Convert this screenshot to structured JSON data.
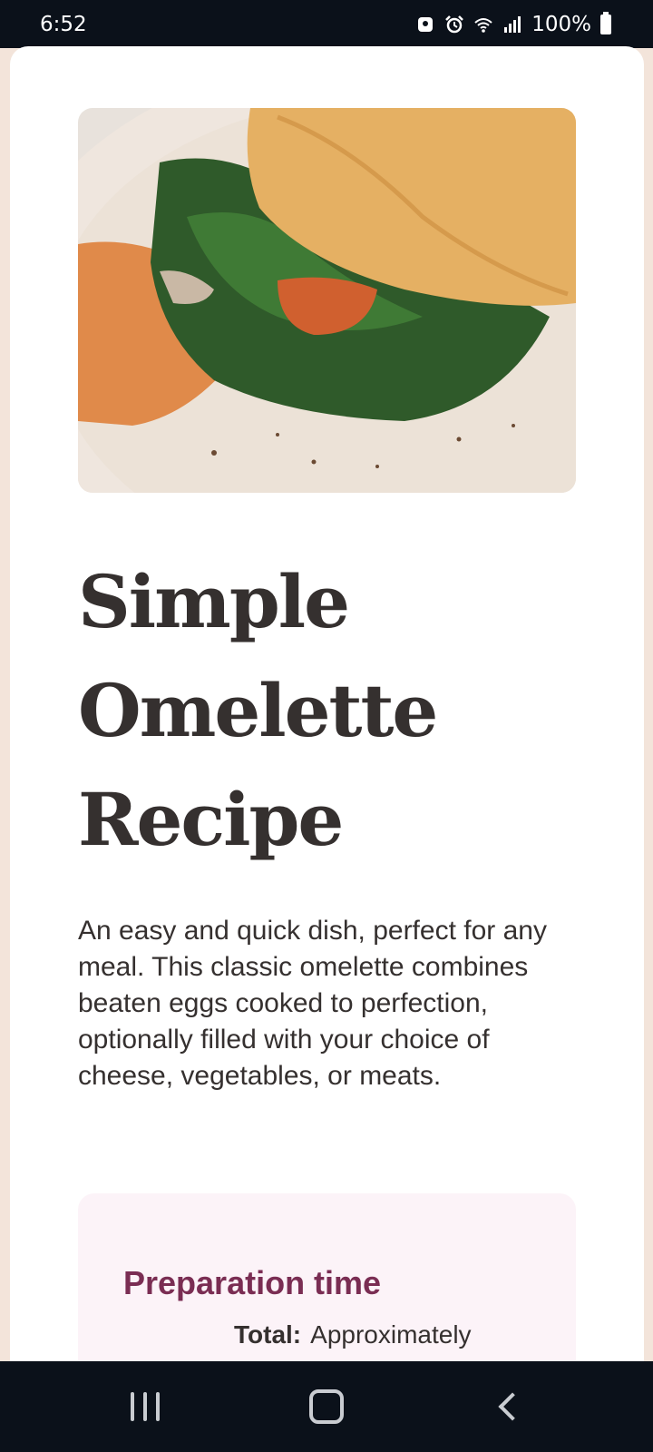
{
  "status_bar": {
    "time": "6:52",
    "battery": "100%",
    "icons": [
      "notification-icon",
      "alarm-icon",
      "wifi-icon",
      "signal-icon",
      "battery-icon"
    ]
  },
  "recipe": {
    "image_alt": "omelette-with-spinach-on-plate",
    "title": "Simple Omelette Recipe",
    "description": "An easy and quick dish, perfect for any meal. This classic omelette combines beaten eggs cooked to perfection, optionally filled with your choice of cheese, vegetables, or meats.",
    "preparation": {
      "heading": "Preparation time",
      "rows": [
        {
          "label": "Total:",
          "value": "Approximately"
        }
      ]
    }
  },
  "colors": {
    "page_background": "#f3e4da",
    "card": "#ffffff",
    "title_text": "#35302f",
    "prep_box": "#fcf3f8",
    "prep_heading": "#7a2d53",
    "system_bars": "#0b111a"
  },
  "nav_bar": {
    "buttons": [
      "recent-apps-icon",
      "home-icon",
      "back-icon"
    ]
  }
}
